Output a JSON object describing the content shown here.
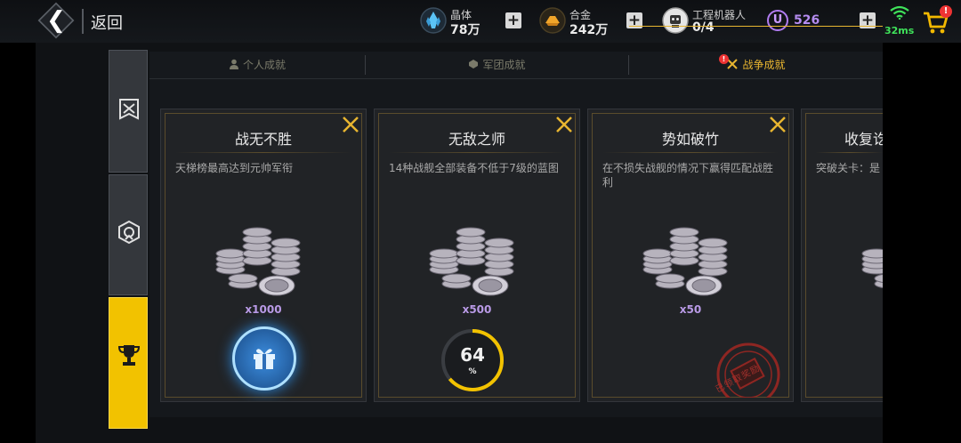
{
  "header": {
    "back_label": "返回",
    "resources": [
      {
        "icon": "crystal-icon",
        "name": "晶体",
        "value": "78万"
      },
      {
        "icon": "alloy-icon",
        "name": "合金",
        "value": "242万"
      },
      {
        "icon": "robot-icon",
        "name": "工程机器人",
        "value": "0/4"
      }
    ],
    "u_icon_label": "U",
    "u_value": "526",
    "ping": "32ms",
    "cart_badge": "!"
  },
  "tabs": [
    {
      "label": "个人成就",
      "active": false
    },
    {
      "label": "军团成就",
      "active": false
    },
    {
      "label": "战争成就",
      "active": true
    }
  ],
  "tab_badge": "!",
  "cards": [
    {
      "title": "战无不胜",
      "desc": "天梯榜最高达到元帅军衔",
      "qty": "x1000",
      "state": "claim"
    },
    {
      "title": "无敌之师",
      "desc": "14种战舰全部装备不低于7级的蓝图",
      "qty": "x500",
      "state": "progress",
      "progress_value": "64",
      "progress_unit": "%",
      "progress_fraction": 0.64
    },
    {
      "title": "势如破竹",
      "desc": "在不损失战舰的情况下赢得匹配战胜利",
      "qty": "x50",
      "state": "claimed",
      "stamp_text": "已领取奖励"
    },
    {
      "title": "收复讫",
      "desc": "突破关卡：是",
      "qty": "",
      "state": "partial"
    }
  ],
  "colors": {
    "accent": "#e8b530",
    "claim_blue": "#2e8fe8",
    "progress_yellow": "#f2c200",
    "stamp_red": "#a2302c",
    "qty_purple": "#b99ae6"
  }
}
